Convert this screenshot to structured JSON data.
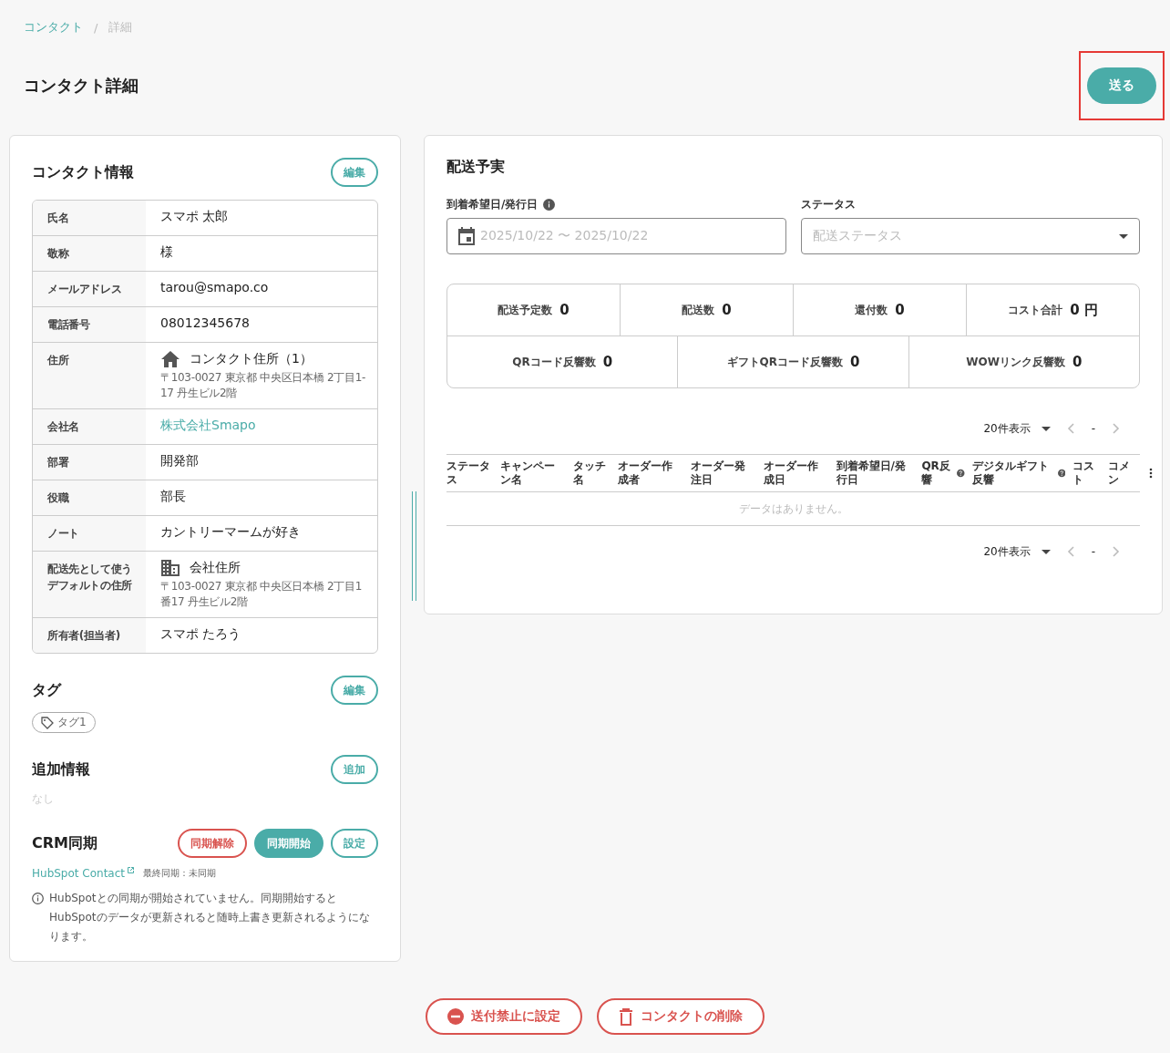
{
  "breadcrumb": [
    {
      "label": "コンタクト",
      "link": true
    },
    {
      "label": "詳細",
      "link": false
    }
  ],
  "breadcrumb_separator": "/",
  "page_title": "コンタクト詳細",
  "send_button": {
    "label": "送る",
    "highlighted": true
  },
  "contact_info": {
    "title": "コンタクト情報",
    "edit_button": "編集",
    "rows": [
      {
        "kind": "text",
        "label": "氏名",
        "value": "スマポ 太郎"
      },
      {
        "kind": "text",
        "label": "敬称",
        "value": "様"
      },
      {
        "kind": "text",
        "label": "メールアドレス",
        "value": "tarou@smapo.co"
      },
      {
        "kind": "text",
        "label": "電話番号",
        "value": "08012345678"
      },
      {
        "kind": "address",
        "label": "住所",
        "value": "コンタクト住所（1）",
        "detail": "〒103-0027 東京都 中央区日本橋 2丁目1-17 丹生ビル2階"
      },
      {
        "kind": "link",
        "label": "会社名",
        "value": "株式会社Smapo"
      },
      {
        "kind": "text",
        "label": "部署",
        "value": "開発部"
      },
      {
        "kind": "text",
        "label": "役職",
        "value": "部長"
      },
      {
        "kind": "text",
        "label": "ノート",
        "value": "カントリーマームが好き"
      },
      {
        "kind": "address",
        "label": "配送先として使うデフォルトの住所",
        "value": "会社住所",
        "detail": "〒103-0027 東京都 中央区日本橋 2丁目1番17 丹生ビル2階"
      },
      {
        "kind": "text",
        "label": "所有者(担当者)",
        "value": "スマポ たろう"
      }
    ]
  },
  "tags": {
    "title": "タグ",
    "edit_button": "編集",
    "items": [
      "タグ1"
    ]
  },
  "additional_info": {
    "title": "追加情報",
    "add_button": "追加",
    "empty_text": "なし"
  },
  "crm_sync": {
    "title": "CRM同期",
    "buttons": [
      {
        "label": "同期解除",
        "kind": "danger"
      },
      {
        "label": "同期開始",
        "kind": "primary"
      },
      {
        "label": "設定",
        "kind": "outline"
      }
    ],
    "link": "HubSpot Contact",
    "last_sync": "最終同期：未同期",
    "notice": "HubSpotとの同期が開始されていません。同期開始するとHubSpotのデータが更新されると随時上書き更新されるようになります。"
  },
  "delivery": {
    "title": "配送予実",
    "date_filter": {
      "label": "到着希望日/発行日",
      "placeholder": "2025/10/22 〜 2025/10/22"
    },
    "status_filter": {
      "label": "ステータス",
      "placeholder": "配送ステータス"
    },
    "stats_row_1": [
      {
        "label": "配送予定数",
        "value": "0"
      },
      {
        "label": "配送数",
        "value": "0"
      },
      {
        "label": "還付数",
        "value": "0"
      },
      {
        "label": "コスト合計",
        "value": "0 円"
      }
    ],
    "stats_row_2": [
      {
        "label": "QRコード反響数",
        "value": "0"
      },
      {
        "label": "ギフトQRコード反響数",
        "value": "0"
      },
      {
        "label": "WOWリンク反響数",
        "value": "0"
      }
    ],
    "pagination_top": {
      "page_size": "20件表示",
      "page": "-"
    },
    "table": {
      "columns": [
        {
          "label": "ステータス",
          "help": false
        },
        {
          "label": "キャンペーン名",
          "help": false
        },
        {
          "label": "タッチ名",
          "help": false
        },
        {
          "label": "オーダー作成者",
          "help": false
        },
        {
          "label": "オーダー発注日",
          "help": false
        },
        {
          "label": "オーダー作成日",
          "help": false
        },
        {
          "label": "到着希望日/発行日",
          "help": false
        },
        {
          "label": "QR反響",
          "help": true
        },
        {
          "label": "デジタルギフト反響",
          "help": true
        },
        {
          "label": "コスト",
          "help": false
        },
        {
          "label": "コメン",
          "help": false
        }
      ],
      "empty_text": "データはありません。"
    },
    "pagination_bottom": {
      "page_size": "20件表示",
      "page": "-"
    }
  },
  "footer_buttons": [
    "送付禁止に設定",
    "コンタクトの削除"
  ]
}
